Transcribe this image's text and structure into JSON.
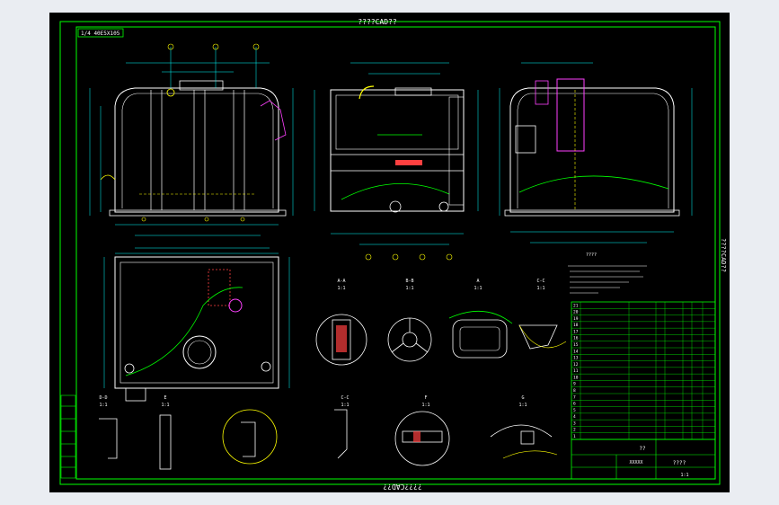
{
  "colors": {
    "page_bg": "#eaedf2",
    "canvas_bg": "#000000",
    "frame": "#00ff00",
    "lines": "#ffffff",
    "dims": "#00ffff",
    "hidden": "#ffff00",
    "accent": "#ff40ff",
    "outline": "#00ff00",
    "hatch": "#ff4040"
  },
  "title_top": "????CAD??",
  "title_bottom": "????CAD??",
  "side_label": "????CAD??",
  "stamp_label": "1/4 40E5X105",
  "tech_label": "????",
  "sections": [
    {
      "label": "A-A",
      "scale": "1:1"
    },
    {
      "label": "B-B",
      "scale": "1:1"
    },
    {
      "label": "A",
      "scale": "1:1"
    },
    {
      "label": "C-C",
      "scale": "1:1"
    },
    {
      "label": "D-D",
      "scale": "1:1"
    },
    {
      "label": "E",
      "scale": "1:1"
    },
    {
      "label": "C-C",
      "scale": "1:1"
    },
    {
      "label": "F",
      "scale": "1:1"
    },
    {
      "label": "G",
      "scale": "1:1"
    }
  ],
  "bom_rows": [
    "21",
    "20",
    "19",
    "18",
    "17",
    "16",
    "15",
    "14",
    "13",
    "12",
    "11",
    "10",
    "9",
    "8",
    "7",
    "6",
    "5",
    "4",
    "3",
    "2",
    "1"
  ],
  "title_block": {
    "block_a": "??",
    "block_b": "????",
    "block_c": "XXXXX",
    "block_d": "1:1"
  }
}
